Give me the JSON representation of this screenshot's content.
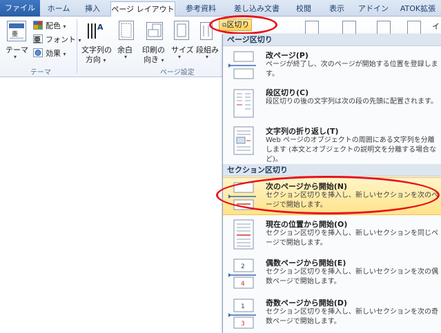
{
  "tabs": [
    "ファイル",
    "ホーム",
    "挿入",
    "ページ レイアウト",
    "参考資料",
    "差し込み文書",
    "校閲",
    "表示",
    "アドイン",
    "ATOK拡張"
  ],
  "ribbon": {
    "theme_label": "テーマ",
    "colors_label": "配色",
    "fonts_label": "フォント",
    "effects_label": "効果",
    "theme_group": "テーマ",
    "text_direction_line1": "文字列の",
    "text_direction_line2": "方向",
    "margins_label": "余白",
    "orientation_line1": "印刷の",
    "orientation_line2": "向き",
    "size_label": "サイズ",
    "columns_label": "段組み",
    "page_setup_group": "ページ設定",
    "breaks_button": "区切り",
    "right_cut_label": "イ"
  },
  "menu": {
    "page_breaks_header": "ページ区切り",
    "section_breaks_header": "セクション区切り",
    "items": [
      {
        "title": "改ページ(P)",
        "desc": "ページが終了し、次のページが開始する位置を登録します。"
      },
      {
        "title": "段区切り(C)",
        "desc": "段区切りの後の文字列は次の段の先頭に配置されます。"
      },
      {
        "title": "文字列の折り返し(T)",
        "desc": "Web ページのオブジェクトの周囲にある文字列を分離します (本文とオブジェクトの説明文を分離する場合など)。"
      },
      {
        "title": "次のページから開始(N)",
        "desc": "セクション区切りを挿入し、新しいセクションを次のページで開始します。"
      },
      {
        "title": "現在の位置から開始(O)",
        "desc": "セクション区切りを挿入し、新しいセクションを同じページで開始します。"
      },
      {
        "title": "偶数ページから開始(E)",
        "desc": "セクション区切りを挿入し、新しいセクションを次の偶数ページで開始します。"
      },
      {
        "title": "奇数ページから開始(D)",
        "desc": "セクション区切りを挿入し、新しいセクションを次の奇数ページで開始します。"
      }
    ],
    "icon_numbers": [
      "2",
      "4",
      "1",
      "3"
    ]
  },
  "colors": {
    "accent": "#2a5ea6",
    "highlight": "#ffe38a",
    "annotation": "#e8121a"
  }
}
